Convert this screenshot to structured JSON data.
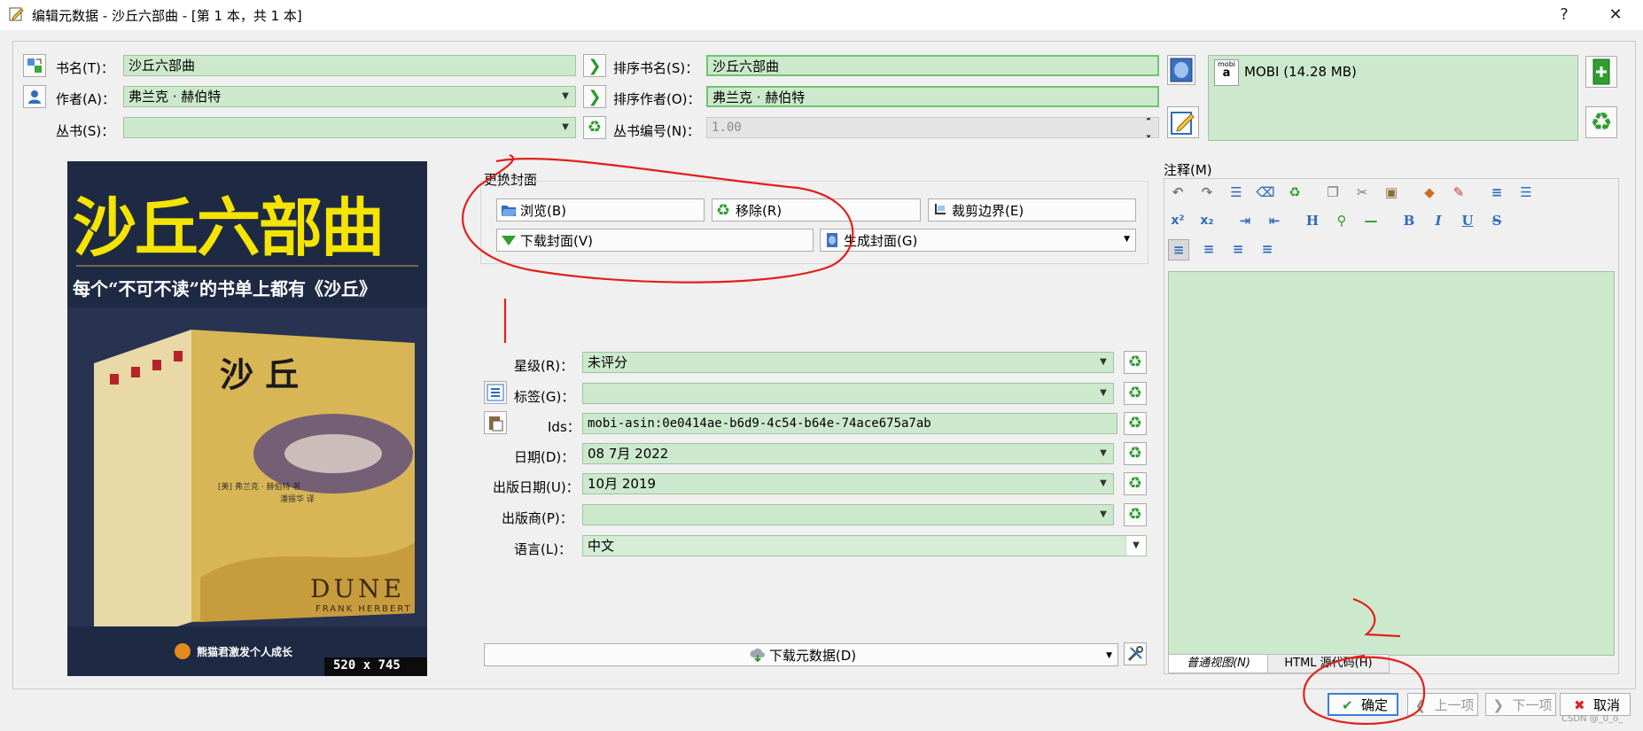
{
  "window": {
    "title": "编辑元数据 - 沙丘六部曲 - [第 1 本，共 1 本]",
    "help": "?",
    "close": "✕"
  },
  "fields": {
    "title_label": "书名(T)：",
    "title_value": "沙丘六部曲",
    "author_label": "作者(A)：",
    "author_value": "弗兰克 · 赫伯特",
    "series_label": "丛书(S)：",
    "series_value": "",
    "sort_title_label": "排序书名(S)：",
    "sort_title_value": "沙丘六部曲",
    "sort_author_label": "排序作者(O)：",
    "sort_author_value": "弗兰克 · 赫伯特",
    "series_index_label": "丛书编号(N)：",
    "series_index_value": "1.00"
  },
  "formats": {
    "item": "MOBI (14.28 MB)",
    "mobi_icon_text": "mobi"
  },
  "cover_panel": {
    "group_title": "更换封面",
    "browse": "浏览(B)",
    "remove": "移除(R)",
    "trim": "裁剪边界(E)",
    "download": "下载封面(V)",
    "generate": "生成封面(G)",
    "size": "520 x 745"
  },
  "cover_image": {
    "title": "沙丘六部曲",
    "subtitle": "每个“不可不读”的书单上都有《沙丘》",
    "book_title": "沙 丘",
    "author_line": "[美] 弗兰克 · 赫伯特 著",
    "translator": "潘振华 译",
    "dune": "DUNE",
    "frank": "FRANK HERBERT",
    "publisher": "熊猫君激发个人成长",
    "spine_labels": [
      "沙丘",
      "沙丘",
      "沙丘",
      "沙丘",
      "沙丘"
    ]
  },
  "meta": {
    "rating_label": "星级(R)：",
    "rating_value": "未评分",
    "tags_label": "标签(G)：",
    "tags_value": "",
    "ids_label": "Ids：",
    "ids_value": "mobi-asin:0e0414ae-b6d9-4c54-b64e-74ace675a7ab",
    "date_label": "日期(D)：",
    "date_value": "08 7月 2022",
    "pubdate_label": "出版日期(U)：",
    "pubdate_value": "10月 2019",
    "publisher_label": "出版商(P)：",
    "publisher_value": "",
    "language_label": "语言(L)：",
    "language_value": "中文"
  },
  "download_metadata": "下载元数据(D)",
  "comments": {
    "label": "注释(M)",
    "tab_normal": "普通视图(N)",
    "tab_html": "HTML 源代码(H)"
  },
  "footer": {
    "ok": "确定",
    "prev": "上一项",
    "next": "下一项",
    "cancel": "取消",
    "watermark": "CSDN @_0_o_"
  },
  "colors": {
    "field_bg": "#cde9cd",
    "accent_red": "#e0201a",
    "cover_yellow": "#f4e400"
  }
}
